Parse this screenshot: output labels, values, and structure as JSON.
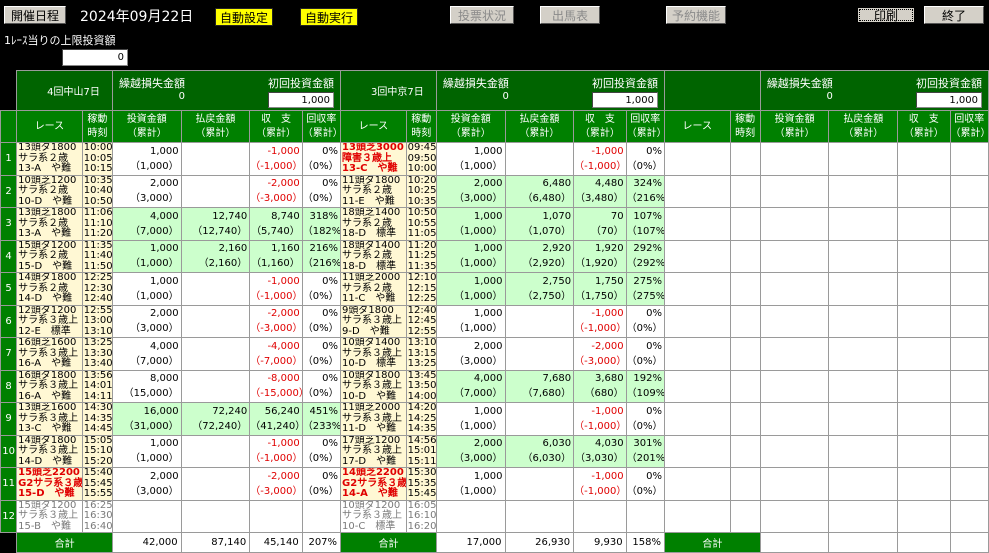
{
  "toolbar": {
    "schedule": "開催日程",
    "date": "2024年09月22日",
    "auto_setting": "自動設定",
    "auto_run": "自動実行",
    "vote_status": "投票状況",
    "entries": "出馬表",
    "reserve": "予約機能",
    "print": "印刷",
    "exit": "終了"
  },
  "limit": {
    "label": "1ﾚｰｽ当りの上限投資額",
    "value": "0"
  },
  "headers": {
    "carry_loss": "繰越損失金額",
    "first_invest": "初回投資金額",
    "race": "レース",
    "time": [
      "稼動",
      "時刻"
    ],
    "invest": [
      "投資金額",
      "（累計）"
    ],
    "payout": [
      "払戻金額",
      "（累計）"
    ],
    "balance": [
      "収　支",
      "（累計）"
    ],
    "rate": [
      "回収率",
      "（累計）"
    ],
    "total": "合計"
  },
  "venues": [
    {
      "name": "4回中山7日",
      "carry": "0",
      "first": "1,000",
      "totals": {
        "invest": "42,000",
        "payout": "87,140",
        "balance": "45,140",
        "rate": "207%"
      },
      "races": [
        {
          "info": [
            "13頭ダ1800",
            "サラ系２歳",
            "13-A　や難"
          ],
          "time": [
            "10:00",
            "10:05",
            "10:15"
          ],
          "style": "",
          "inv": [
            "1,000",
            "（1,000）"
          ],
          "pay": [
            "",
            ""
          ],
          "bal": [
            "-1,000",
            "（-1,000）"
          ],
          "rate": [
            "0%",
            "（0%）"
          ],
          "g": false
        },
        {
          "info": [
            "10頭芝1200",
            "サラ系２歳",
            "10-D　や難"
          ],
          "time": [
            "10:35",
            "10:40",
            "10:50"
          ],
          "style": "",
          "inv": [
            "2,000",
            "（3,000）"
          ],
          "pay": [
            "",
            ""
          ],
          "bal": [
            "-2,000",
            "（-3,000）"
          ],
          "rate": [
            "0%",
            "（0%）"
          ],
          "g": false
        },
        {
          "info": [
            "13頭芝1800",
            "サラ系２歳",
            "13-A　や難"
          ],
          "time": [
            "11:06",
            "11:10",
            "11:20"
          ],
          "style": "",
          "inv": [
            "4,000",
            "（7,000）"
          ],
          "pay": [
            "12,740",
            "（12,740）"
          ],
          "bal": [
            "8,740",
            "（5,740）"
          ],
          "rate": [
            "318%",
            "（182%）"
          ],
          "g": true
        },
        {
          "info": [
            "15頭ダ1200",
            "サラ系２歳",
            "15-D　や難"
          ],
          "time": [
            "11:35",
            "11:40",
            "11:50"
          ],
          "style": "",
          "inv": [
            "1,000",
            "（1,000）"
          ],
          "pay": [
            "2,160",
            "（2,160）"
          ],
          "bal": [
            "1,160",
            "（1,160）"
          ],
          "rate": [
            "216%",
            "（216%）"
          ],
          "g": true
        },
        {
          "info": [
            "14頭ダ1800",
            "サラ系２歳",
            "14-D　や難"
          ],
          "time": [
            "12:25",
            "12:30",
            "12:40"
          ],
          "style": "",
          "inv": [
            "1,000",
            "（1,000）"
          ],
          "pay": [
            "",
            ""
          ],
          "bal": [
            "-1,000",
            "（-1,000）"
          ],
          "rate": [
            "0%",
            "（0%）"
          ],
          "g": false
        },
        {
          "info": [
            "12頭ダ1200",
            "サラ系３歳上",
            "12-E　標準"
          ],
          "time": [
            "12:55",
            "13:00",
            "13:10"
          ],
          "style": "",
          "inv": [
            "2,000",
            "（3,000）"
          ],
          "pay": [
            "",
            ""
          ],
          "bal": [
            "-2,000",
            "（-3,000）"
          ],
          "rate": [
            "0%",
            "（0%）"
          ],
          "g": false
        },
        {
          "info": [
            "16頭芝1600",
            "サラ系３歳上",
            "16-A　や難"
          ],
          "time": [
            "13:25",
            "13:30",
            "13:40"
          ],
          "style": "",
          "inv": [
            "4,000",
            "（7,000）"
          ],
          "pay": [
            "",
            ""
          ],
          "bal": [
            "-4,000",
            "（-7,000）"
          ],
          "rate": [
            "0%",
            "（0%）"
          ],
          "g": false
        },
        {
          "info": [
            "16頭ダ1800",
            "サラ系３歳上",
            "16-A　や難"
          ],
          "time": [
            "13:56",
            "14:01",
            "14:11"
          ],
          "style": "",
          "inv": [
            "8,000",
            "（15,000）"
          ],
          "pay": [
            "",
            ""
          ],
          "bal": [
            "-8,000",
            "（-15,000）"
          ],
          "rate": [
            "0%",
            "（0%）"
          ],
          "g": false
        },
        {
          "info": [
            "13頭芝1600",
            "サラ系３歳上",
            "13-C　や難"
          ],
          "time": [
            "14:30",
            "14:35",
            "14:45"
          ],
          "style": "",
          "inv": [
            "16,000",
            "（31,000）"
          ],
          "pay": [
            "72,240",
            "（72,240）"
          ],
          "bal": [
            "56,240",
            "（41,240）"
          ],
          "rate": [
            "451%",
            "（233%）"
          ],
          "g": true
        },
        {
          "info": [
            "14頭ダ1800",
            "サラ系３歳上",
            "14-D　や難"
          ],
          "time": [
            "15:05",
            "15:10",
            "15:20"
          ],
          "style": "",
          "inv": [
            "1,000",
            "（1,000）"
          ],
          "pay": [
            "",
            ""
          ],
          "bal": [
            "-1,000",
            "（-1,000）"
          ],
          "rate": [
            "0%",
            "（0%）"
          ],
          "g": false
        },
        {
          "info": [
            "15頭芝2200",
            "G2サラ系３歳",
            "15-D　や難"
          ],
          "time": [
            "15:40",
            "15:45",
            "15:55"
          ],
          "style": "red",
          "inv": [
            "2,000",
            "（3,000）"
          ],
          "pay": [
            "",
            ""
          ],
          "bal": [
            "-2,000",
            "（-3,000）"
          ],
          "rate": [
            "0%",
            "（0%）"
          ],
          "g": false
        },
        {
          "info": [
            "15頭ダ1200",
            "サラ系３歳上",
            "15-B　や難"
          ],
          "time": [
            "16:25",
            "16:30",
            "16:40"
          ],
          "style": "gry",
          "inv": [
            "",
            ""
          ],
          "pay": [
            "",
            ""
          ],
          "bal": [
            "",
            ""
          ],
          "rate": [
            "",
            ""
          ],
          "g": false
        }
      ]
    },
    {
      "name": "3回中京7日",
      "carry": "0",
      "first": "1,000",
      "totals": {
        "invest": "17,000",
        "payout": "26,930",
        "balance": "9,930",
        "rate": "158%"
      },
      "races": [
        {
          "info": [
            "13頭芝3000",
            "障害３歳上",
            "13-C　や難"
          ],
          "time": [
            "09:45",
            "09:50",
            "10:00"
          ],
          "style": "red",
          "inv": [
            "1,000",
            "（1,000）"
          ],
          "pay": [
            "",
            ""
          ],
          "bal": [
            "-1,000",
            "（-1,000）"
          ],
          "rate": [
            "0%",
            "（0%）"
          ],
          "g": false
        },
        {
          "info": [
            "11頭ダ1800",
            "サラ系２歳",
            "11-E　や難"
          ],
          "time": [
            "10:20",
            "10:25",
            "10:35"
          ],
          "style": "",
          "inv": [
            "2,000",
            "（3,000）"
          ],
          "pay": [
            "6,480",
            "（6,480）"
          ],
          "bal": [
            "4,480",
            "（3,480）"
          ],
          "rate": [
            "324%",
            "（216%）"
          ],
          "g": true
        },
        {
          "info": [
            "18頭芝1400",
            "サラ系２歳",
            "18-D　標準"
          ],
          "time": [
            "10:50",
            "10:55",
            "11:05"
          ],
          "style": "",
          "inv": [
            "1,000",
            "（1,000）"
          ],
          "pay": [
            "1,070",
            "（1,070）"
          ],
          "bal": [
            "70",
            "（70）"
          ],
          "rate": [
            "107%",
            "（107%）"
          ],
          "g": true
        },
        {
          "info": [
            "18頭ダ1400",
            "サラ系２歳",
            "18-D　標準"
          ],
          "time": [
            "11:20",
            "11:25",
            "11:35"
          ],
          "style": "",
          "inv": [
            "1,000",
            "（1,000）"
          ],
          "pay": [
            "2,920",
            "（2,920）"
          ],
          "bal": [
            "1,920",
            "（1,920）"
          ],
          "rate": [
            "292%",
            "（292%）"
          ],
          "g": true
        },
        {
          "info": [
            "11頭芝2000",
            "サラ系２歳",
            "11-C　や難"
          ],
          "time": [
            "12:10",
            "12:15",
            "12:25"
          ],
          "style": "",
          "inv": [
            "1,000",
            "（1,000）"
          ],
          "pay": [
            "2,750",
            "（2,750）"
          ],
          "bal": [
            "1,750",
            "（1,750）"
          ],
          "rate": [
            "275%",
            "（275%）"
          ],
          "g": true
        },
        {
          "info": [
            "9頭ダ1800",
            "サラ系３歳上",
            "9-D　や難"
          ],
          "time": [
            "12:40",
            "12:45",
            "12:55"
          ],
          "style": "",
          "inv": [
            "1,000",
            "（1,000）"
          ],
          "pay": [
            "",
            ""
          ],
          "bal": [
            "-1,000",
            "（-1,000）"
          ],
          "rate": [
            "0%",
            "（0%）"
          ],
          "g": false
        },
        {
          "info": [
            "10頭ダ1400",
            "サラ系３歳上",
            "10-D　標準"
          ],
          "time": [
            "13:10",
            "13:15",
            "13:25"
          ],
          "style": "",
          "inv": [
            "2,000",
            "（3,000）"
          ],
          "pay": [
            "",
            ""
          ],
          "bal": [
            "-2,000",
            "（-3,000）"
          ],
          "rate": [
            "0%",
            "（0%）"
          ],
          "g": false
        },
        {
          "info": [
            "10頭ダ1800",
            "サラ系３歳上",
            "10-D　や難"
          ],
          "time": [
            "13:45",
            "13:50",
            "14:00"
          ],
          "style": "",
          "inv": [
            "4,000",
            "（7,000）"
          ],
          "pay": [
            "7,680",
            "（7,680）"
          ],
          "bal": [
            "3,680",
            "（680）"
          ],
          "rate": [
            "192%",
            "（109%）"
          ],
          "g": true
        },
        {
          "info": [
            "11頭芝2000",
            "サラ系３歳上",
            "11-D　や難"
          ],
          "time": [
            "14:20",
            "14:25",
            "14:35"
          ],
          "style": "",
          "inv": [
            "1,000",
            "（1,000）"
          ],
          "pay": [
            "",
            ""
          ],
          "bal": [
            "-1,000",
            "（-1,000）"
          ],
          "rate": [
            "0%",
            "（0%）"
          ],
          "g": false
        },
        {
          "info": [
            "17頭芝1200",
            "サラ系３歳上",
            "17-D　や難"
          ],
          "time": [
            "14:56",
            "15:01",
            "15:11"
          ],
          "style": "",
          "inv": [
            "2,000",
            "（3,000）"
          ],
          "pay": [
            "6,030",
            "（6,030）"
          ],
          "bal": [
            "4,030",
            "（3,030）"
          ],
          "rate": [
            "301%",
            "（201%）"
          ],
          "g": true
        },
        {
          "info": [
            "14頭芝2200",
            "G2サラ系３歳",
            "14-A　や難"
          ],
          "time": [
            "15:30",
            "15:35",
            "15:45"
          ],
          "style": "red",
          "inv": [
            "1,000",
            "（1,000）"
          ],
          "pay": [
            "",
            ""
          ],
          "bal": [
            "-1,000",
            "（-1,000）"
          ],
          "rate": [
            "0%",
            "（0%）"
          ],
          "g": false
        },
        {
          "info": [
            "10頭ダ1200",
            "サラ系３歳上",
            "10-C　標準"
          ],
          "time": [
            "16:05",
            "16:10",
            "16:20"
          ],
          "style": "gry",
          "inv": [
            "",
            ""
          ],
          "pay": [
            "",
            ""
          ],
          "bal": [
            "",
            ""
          ],
          "rate": [
            "",
            ""
          ],
          "g": false
        }
      ]
    },
    {
      "name": "",
      "carry": "0",
      "first": "1,000",
      "totals": {
        "invest": "",
        "payout": "",
        "balance": "",
        "rate": ""
      },
      "races": []
    }
  ]
}
